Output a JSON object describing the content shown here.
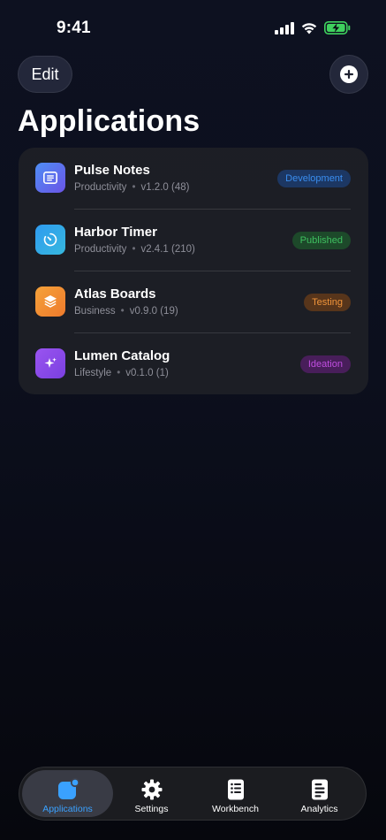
{
  "status": {
    "time": "9:41"
  },
  "header": {
    "edit_label": "Edit",
    "title": "Applications"
  },
  "apps": [
    {
      "name": "Pulse Notes",
      "category": "Productivity",
      "version": "v1.2.0 (48)",
      "status": "Development",
      "icon": "notes-icon"
    },
    {
      "name": "Harbor Timer",
      "category": "Productivity",
      "version": "v2.4.1 (210)",
      "status": "Published",
      "icon": "timer-icon"
    },
    {
      "name": "Atlas Boards",
      "category": "Business",
      "version": "v0.9.0 (19)",
      "status": "Testing",
      "icon": "layers-icon"
    },
    {
      "name": "Lumen Catalog",
      "category": "Lifestyle",
      "version": "v0.1.0 (1)",
      "status": "Ideation",
      "icon": "sparkles-icon"
    }
  ],
  "tabs": [
    {
      "label": "Applications",
      "icon": "app-square-icon",
      "active": true
    },
    {
      "label": "Settings",
      "icon": "gear-icon",
      "active": false
    },
    {
      "label": "Workbench",
      "icon": "checklist-icon",
      "active": false
    },
    {
      "label": "Analytics",
      "icon": "document-icon",
      "active": false
    }
  ],
  "colors": {
    "accent": "#3aa1ff",
    "development": "#3a8ef0",
    "published": "#3fc060",
    "testing": "#f0943a",
    "ideation": "#b04ad8"
  }
}
